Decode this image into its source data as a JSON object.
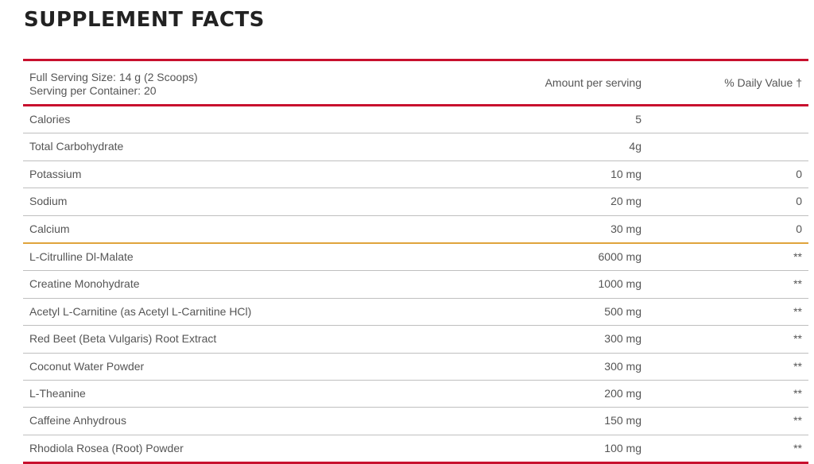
{
  "title": "SUPPLEMENT FACTS",
  "header": {
    "serving_size": "Full Serving Size: 14 g (2 Scoops)",
    "servings_per_container": "Serving per Container: 20",
    "amount_label": "Amount per serving",
    "dv_label": "% Daily Value †"
  },
  "colors": {
    "rule_primary": "#c8102e",
    "rule_divider": "#e0a43c",
    "text": "#555555",
    "title": "#222222"
  },
  "rows": [
    {
      "name": "Calories",
      "amount": "5",
      "dv": ""
    },
    {
      "name": "Total Carbohydrate",
      "amount": "4g",
      "dv": ""
    },
    {
      "name": "Potassium",
      "amount": "10 mg",
      "dv": "0"
    },
    {
      "name": "Sodium",
      "amount": "20 mg",
      "dv": "0"
    },
    {
      "name": "Calcium",
      "amount": "30 mg",
      "dv": "0"
    },
    {
      "name": "L-Citrulline Dl-Malate",
      "amount": "6000 mg",
      "dv": "**"
    },
    {
      "name": "Creatine Monohydrate",
      "amount": "1000 mg",
      "dv": "**"
    },
    {
      "name": "Acetyl L-Carnitine (as Acetyl L-Carnitine HCl)",
      "amount": "500 mg",
      "dv": "**"
    },
    {
      "name": "Red Beet (Beta Vulgaris) Root Extract",
      "amount": "300 mg",
      "dv": "**"
    },
    {
      "name": "Coconut Water Powder",
      "amount": "300 mg",
      "dv": "**"
    },
    {
      "name": "L-Theanine",
      "amount": "200 mg",
      "dv": "**"
    },
    {
      "name": "Caffeine Anhydrous",
      "amount": "150 mg",
      "dv": "**"
    },
    {
      "name": "Rhodiola Rosea (Root) Powder",
      "amount": "100 mg",
      "dv": "**"
    }
  ]
}
